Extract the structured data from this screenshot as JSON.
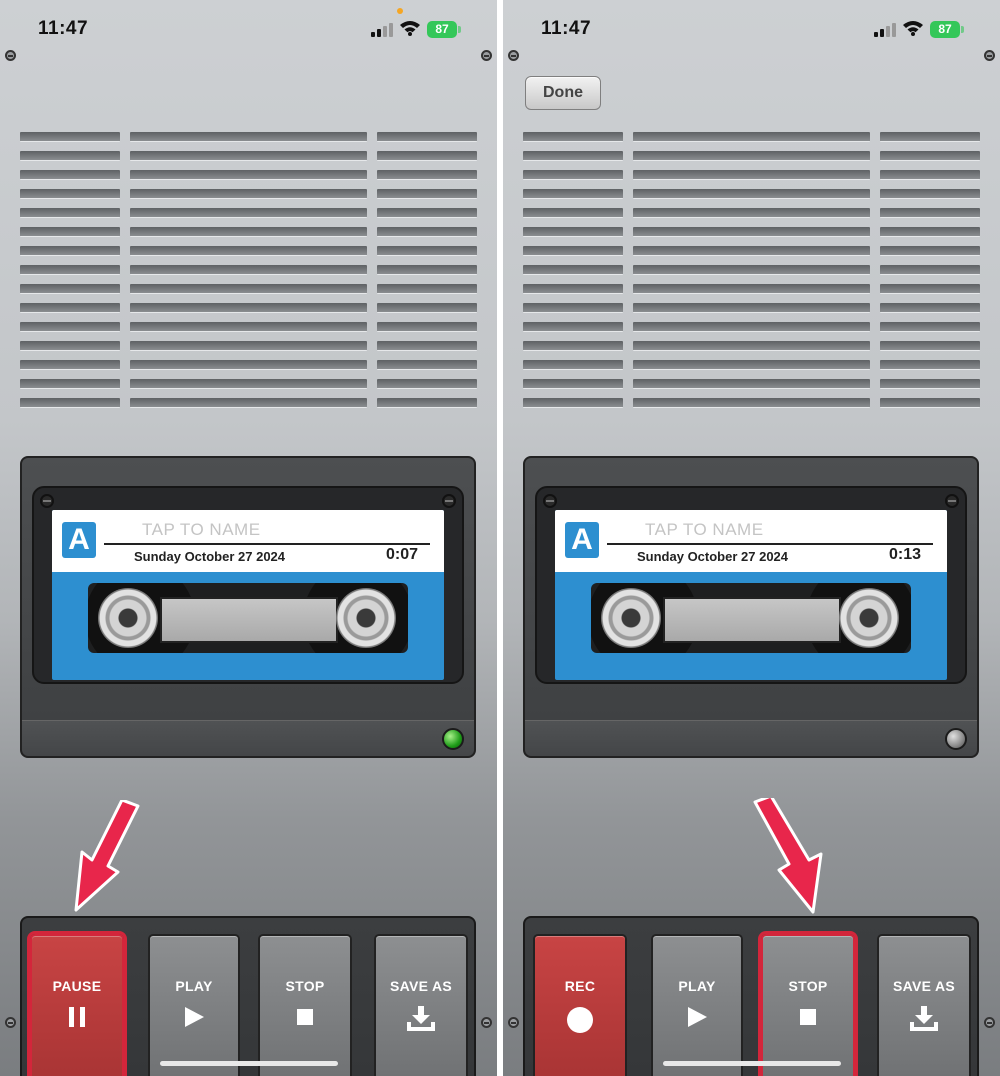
{
  "left": {
    "status": {
      "time": "11:47",
      "battery": "87"
    },
    "cassette": {
      "side": "A",
      "name_placeholder": "TAP TO NAME",
      "date": "Sunday October 27 2024",
      "elapsed": "0:07"
    },
    "indicator": "green",
    "buttons": [
      {
        "label": "PAUSE",
        "icon": "pause-icon",
        "color": "#c84444",
        "highlighted": true
      },
      {
        "label": "PLAY",
        "icon": "play-icon",
        "highlighted": false
      },
      {
        "label": "STOP",
        "icon": "stop-icon",
        "highlighted": false
      },
      {
        "label": "SAVE AS",
        "icon": "download-icon",
        "highlighted": false
      }
    ]
  },
  "right": {
    "status": {
      "time": "11:47",
      "battery": "87"
    },
    "done_label": "Done",
    "cassette": {
      "side": "A",
      "name_placeholder": "TAP TO NAME",
      "date": "Sunday October 27 2024",
      "elapsed": "0:13"
    },
    "indicator": "off",
    "buttons": [
      {
        "label": "REC",
        "icon": "record-icon",
        "color": "#c84444",
        "highlighted": false
      },
      {
        "label": "PLAY",
        "icon": "play-icon",
        "highlighted": false
      },
      {
        "label": "STOP",
        "icon": "stop-icon",
        "highlighted": true
      },
      {
        "label": "SAVE AS",
        "icon": "download-icon",
        "highlighted": false
      }
    ]
  },
  "colors": {
    "highlight": "#d3263b",
    "arrow": "#e8264b",
    "cassette_blue": "#2d8fd0",
    "battery_green": "#34c759"
  }
}
